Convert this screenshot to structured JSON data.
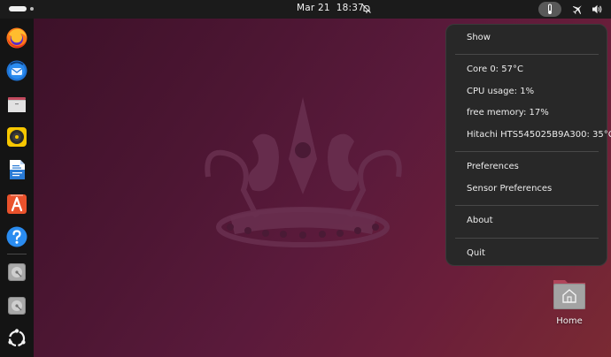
{
  "topbar": {
    "date": "Mar 21",
    "time": "18:37",
    "icons": [
      "activities-pill",
      "dnd-bell-off-icon",
      "thermometer-icon",
      "airplane-mode-icon",
      "volume-icon"
    ]
  },
  "dock": {
    "apps": [
      {
        "name": "firefox-icon"
      },
      {
        "name": "thunderbird-icon"
      },
      {
        "name": "files-icon"
      },
      {
        "name": "rhythmbox-icon"
      },
      {
        "name": "libreoffice-writer-icon"
      },
      {
        "name": "app-center-icon"
      },
      {
        "name": "help-icon"
      },
      {
        "name": "disk-drive-icon"
      },
      {
        "name": "disk-drive-icon"
      },
      {
        "name": "show-apps-icon"
      }
    ]
  },
  "menu": {
    "show": "Show",
    "core0": "Core 0: 57°C",
    "cpu_usage": "CPU usage: 1%",
    "free_memory": "free memory: 17%",
    "disk_temp": "Hitachi HTS545025B9A300: 35°C",
    "preferences": "Preferences",
    "sensor_preferences": "Sensor Preferences",
    "about": "About",
    "quit": "Quit"
  },
  "desktop": {
    "home_label": "Home"
  },
  "colors": {
    "topbar": "#1b1b1b",
    "dock": "#141414",
    "menu_bg": "#282828",
    "wallpaper_dark": "#3a1027",
    "wallpaper_light": "#7a2a33"
  }
}
